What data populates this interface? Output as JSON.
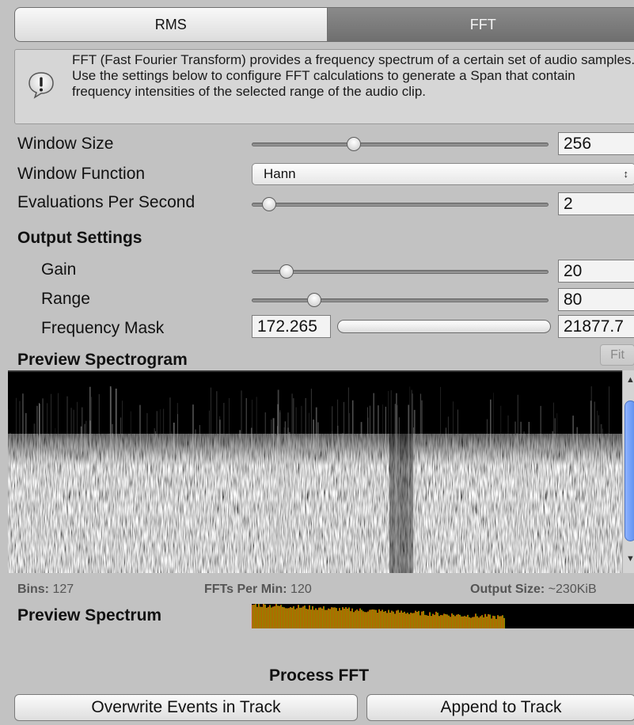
{
  "tabs": {
    "rms": "RMS",
    "fft": "FFT",
    "selected": "FFT"
  },
  "help": {
    "icon": "warning-bubble-icon",
    "text": "FFT (Fast Fourier Transform) provides a frequency spectrum of a certain set of audio samples.  Use the settings below to configure FFT calculations to generate a Span that contain frequency intensities of the selected range of the audio clip."
  },
  "window_size": {
    "label": "Window Size",
    "value": "256",
    "slider_fraction": 0.34
  },
  "window_function": {
    "label": "Window Function",
    "selected": "Hann"
  },
  "evaluations": {
    "label": "Evaluations Per Second",
    "value": "2",
    "slider_fraction": 0.06
  },
  "output_settings": {
    "heading": "Output Settings",
    "gain": {
      "label": "Gain",
      "value": "20",
      "slider_fraction": 0.12
    },
    "range": {
      "label": "Range",
      "value": "80",
      "slider_fraction": 0.21
    },
    "frequency_mask": {
      "label": "Frequency Mask",
      "min": "172.265",
      "max": "21877.7"
    }
  },
  "preview": {
    "heading": "Preview Spectrogram",
    "fit_label": "Fit",
    "bins_label": "Bins:",
    "bins_value": "127",
    "ffts_label": "FFTs Per Min:",
    "ffts_value": "120",
    "output_label": "Output Size:",
    "output_value": "~230KiB"
  },
  "spectrum": {
    "heading": "Preview Spectrum"
  },
  "process": {
    "heading": "Process FFT",
    "overwrite_label": "Overwrite Events in Track",
    "append_label": "Append to Track"
  },
  "colors": {
    "tab_selected": "#767676",
    "scroll_thumb": "#6f9bf5"
  }
}
